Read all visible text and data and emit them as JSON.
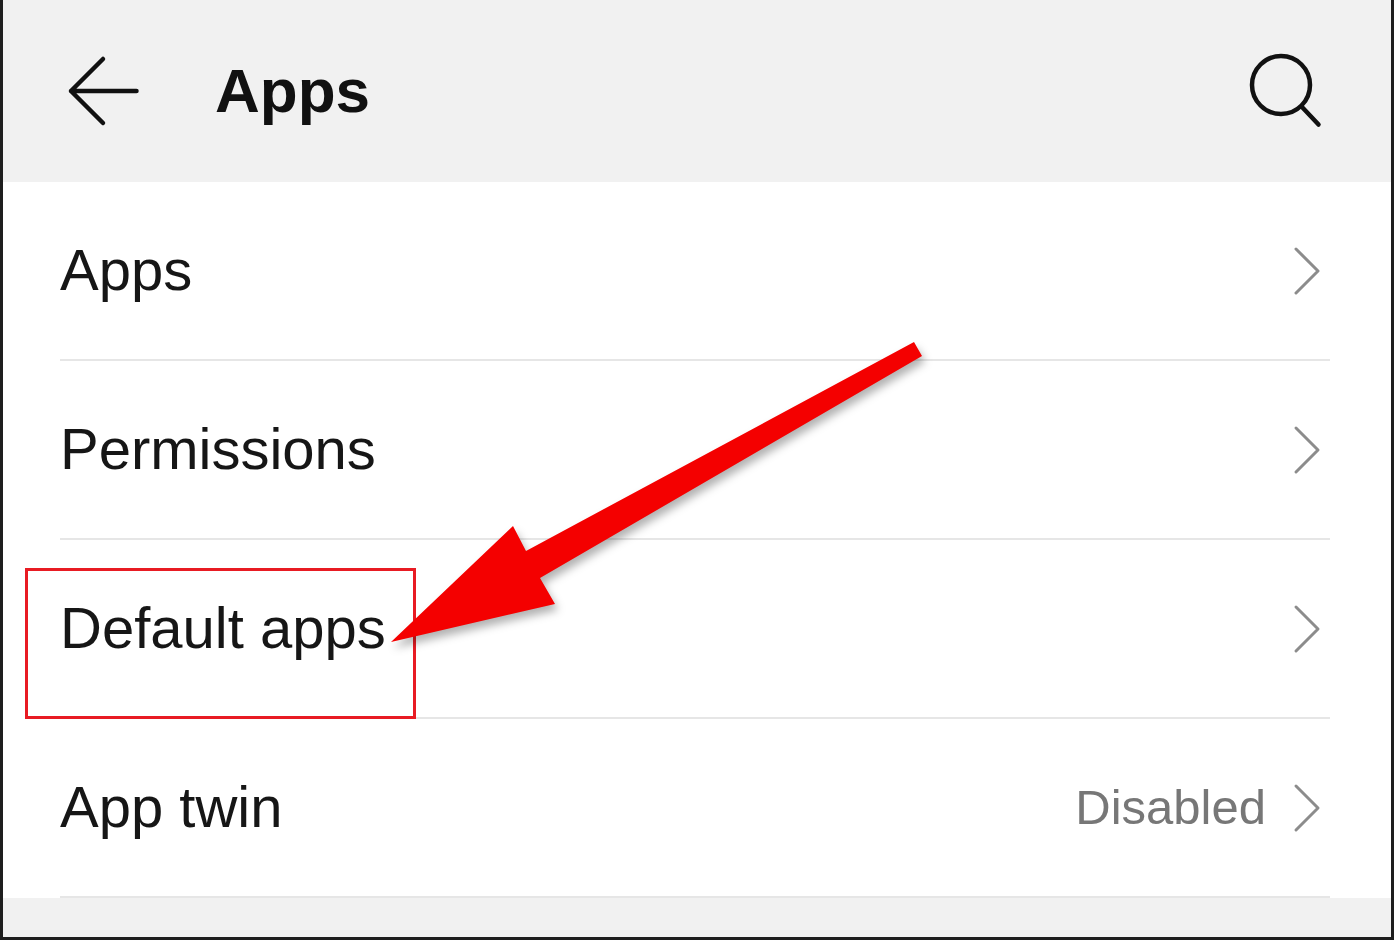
{
  "app_bar": {
    "title": "Apps"
  },
  "rows": [
    {
      "label": "Apps",
      "highlighted": false
    },
    {
      "label": "Permissions",
      "highlighted": false
    },
    {
      "label": "Default apps",
      "highlighted": true
    },
    {
      "label": "App twin",
      "value": "Disabled",
      "highlighted": false
    }
  ]
}
